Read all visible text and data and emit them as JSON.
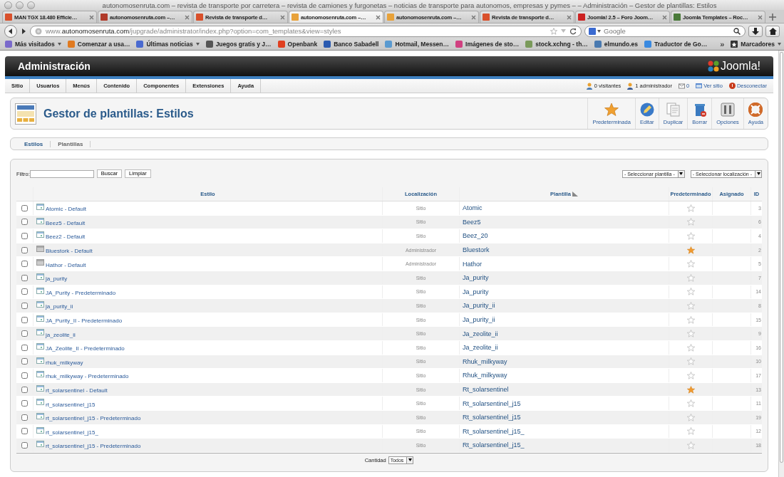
{
  "window": {
    "title": "autonomosenruta.com – revista de transporte por carretera – revista de camiones y furgonetas – noticias de transporte para autonomos, empresas y pymes – – Administración – Gestor de plantillas: Estilos"
  },
  "browser_tabs": [
    {
      "label": "MAN TGX 18.480 Efficie…",
      "color": "#d9502b",
      "selected": false
    },
    {
      "label": "autonomosenruta.com –…",
      "color": "#b03a2a",
      "selected": false
    },
    {
      "label": "Revista de transporte d…",
      "color": "#d9502b",
      "selected": false
    },
    {
      "label": "autonomosenruta.com –…",
      "color": "#e8a23a",
      "selected": true
    },
    {
      "label": "autonomosenruta.com –…",
      "color": "#e8a23a",
      "selected": false
    },
    {
      "label": "Revista de transporte d…",
      "color": "#d9502b",
      "selected": false
    },
    {
      "label": "Joomla! 2.5 – Foro Joom…",
      "color": "#cc2222",
      "selected": false
    },
    {
      "label": "Joomla Templates – Roc…",
      "color": "#4a7a3a",
      "selected": false
    }
  ],
  "address_bar": {
    "value": "www.**autonomosenruta.com**/jupgrade/administrator/index.php?option=com_templates&view=styles"
  },
  "search": {
    "placeholder": "Google"
  },
  "bookmarks": [
    {
      "label": "Más visitados",
      "color": "#7a6acb",
      "menu": true
    },
    {
      "label": "Comenzar a usa…",
      "color": "#e07a20",
      "menu": false
    },
    {
      "label": "Últimas noticias",
      "color": "#4a6ad0",
      "menu": true
    },
    {
      "label": "Juegos gratis y J…",
      "color": "#555555",
      "menu": false
    },
    {
      "label": "Openbank",
      "color": "#e04020",
      "menu": false
    },
    {
      "label": "Banco Sabadell",
      "color": "#2a5ab0",
      "menu": false
    },
    {
      "label": "Hotmail, Messen…",
      "color": "#5a9ad0",
      "menu": false
    },
    {
      "label": "Imágenes de sto…",
      "color": "#d04080",
      "menu": false
    },
    {
      "label": "stock.xchng - th…",
      "color": "#7a9a5a",
      "menu": false
    },
    {
      "label": "elmundo.es",
      "color": "#4a7ab0",
      "menu": false
    },
    {
      "label": "Traductor de Go…",
      "color": "#3a8ae0",
      "menu": false
    }
  ],
  "bookmarks_overflow": "»",
  "bookmarks_menu": "Marcadores",
  "admin": {
    "title": "Administración",
    "logo": "Joomla!"
  },
  "menu": [
    "Sitio",
    "Usuarios",
    "Menús",
    "Contenido",
    "Componentes",
    "Extensiones",
    "Ayuda"
  ],
  "status": [
    {
      "kind": "visitors",
      "label": "0 visitantes",
      "link": false
    },
    {
      "kind": "admins",
      "label": "1 administrador",
      "link": false
    },
    {
      "kind": "messages",
      "label": "0",
      "link": true
    },
    {
      "kind": "view",
      "label": "Ver sitio",
      "link": true
    },
    {
      "kind": "logout",
      "label": "Desconectar",
      "link": true
    }
  ],
  "page_title": "Gestor de plantillas: Estilos",
  "toolbar": [
    {
      "kind": "default",
      "label": "Predeterminada"
    },
    {
      "kind": "edit",
      "label": "Editar"
    },
    {
      "kind": "copy",
      "label": "Duplicar"
    },
    {
      "kind": "delete",
      "label": "Borrar"
    },
    {
      "kind": "options",
      "label": "Opciones"
    },
    {
      "kind": "help",
      "label": "Ayuda"
    }
  ],
  "subtabs": [
    {
      "label": "Estilos",
      "selected": true
    },
    {
      "label": "Plantillas",
      "selected": false
    }
  ],
  "filter": {
    "label": "Filtro:",
    "search_button": "Buscar",
    "clear_button": "Limpiar",
    "template_select": "- Seleccionar plantilla -",
    "location_select": "- Seleccionar localización -"
  },
  "table": {
    "columns": [
      "Estilo",
      "Localización",
      "Plantilla",
      "Predeterminado",
      "Asignado",
      "ID"
    ],
    "rows": [
      {
        "style": "Atomic - Default",
        "kind": "site",
        "location": "Sitio",
        "template": "Atomic",
        "default": false,
        "id": "3",
        "checked": false
      },
      {
        "style": "Beez5 - Default",
        "kind": "site",
        "location": "Sitio",
        "template": "Beez5",
        "default": false,
        "id": "6",
        "checked": false
      },
      {
        "style": "Beez2 - Default",
        "kind": "site",
        "location": "Sitio",
        "template": "Beez_20",
        "default": false,
        "id": "4",
        "checked": false
      },
      {
        "style": "Bluestork - Default",
        "kind": "admin",
        "location": "Administrador",
        "template": "Bluestork",
        "default": true,
        "id": "2",
        "checked": false
      },
      {
        "style": "Hathor - Default",
        "kind": "admin",
        "location": "Administrador",
        "template": "Hathor",
        "default": false,
        "id": "5",
        "checked": false
      },
      {
        "style": "ja_purity",
        "kind": "site",
        "location": "Sitio",
        "template": "Ja_purity",
        "default": false,
        "id": "7",
        "checked": false
      },
      {
        "style": "JA_Purity - Predeterminado",
        "kind": "site",
        "location": "Sitio",
        "template": "Ja_purity",
        "default": false,
        "id": "14",
        "checked": false
      },
      {
        "style": "ja_purity_ii",
        "kind": "site",
        "location": "Sitio",
        "template": "Ja_purity_ii",
        "default": false,
        "id": "8",
        "checked": false
      },
      {
        "style": "JA_Purity_II - Predeterminado",
        "kind": "site",
        "location": "Sitio",
        "template": "Ja_purity_ii",
        "default": false,
        "id": "15",
        "checked": false
      },
      {
        "style": "ja_zeolite_ii",
        "kind": "site",
        "location": "Sitio",
        "template": "Ja_zeolite_ii",
        "default": false,
        "id": "9",
        "checked": false
      },
      {
        "style": "JA_Zeolite_II - Predeterminado",
        "kind": "site",
        "location": "Sitio",
        "template": "Ja_zeolite_ii",
        "default": false,
        "id": "16",
        "checked": false
      },
      {
        "style": "rhuk_milkyway",
        "kind": "site",
        "location": "Sitio",
        "template": "Rhuk_milkyway",
        "default": false,
        "id": "10",
        "checked": false
      },
      {
        "style": "rhuk_milkyway - Predeterminado",
        "kind": "site",
        "location": "Sitio",
        "template": "Rhuk_milkyway",
        "default": false,
        "id": "17",
        "checked": false
      },
      {
        "style": "rt_solarsentinel - Default",
        "kind": "site",
        "location": "Sitio",
        "template": "Rt_solarsentinel",
        "default": true,
        "id": "13",
        "checked": false
      },
      {
        "style": "rt_solarsentinel_j15",
        "kind": "site",
        "location": "Sitio",
        "template": "Rt_solarsentinel_j15",
        "default": false,
        "id": "11",
        "checked": false
      },
      {
        "style": "rt_solarsentinel_j15 - Predeterminado",
        "kind": "site",
        "location": "Sitio",
        "template": "Rt_solarsentinel_j15",
        "default": false,
        "id": "19",
        "checked": false
      },
      {
        "style": "rt_solarsentinel_j15_",
        "kind": "site",
        "location": "Sitio",
        "template": "Rt_solarsentinel_j15_",
        "default": false,
        "id": "12",
        "checked": false
      },
      {
        "style": "rt_solarsentinel_j15 - Predeterminado",
        "kind": "site",
        "location": "Sitio",
        "template": "Rt_solarsentinel_j15_",
        "default": false,
        "id": "18",
        "checked": false
      }
    ]
  },
  "pagination": {
    "label": "Cantidad",
    "select": "Todos"
  }
}
